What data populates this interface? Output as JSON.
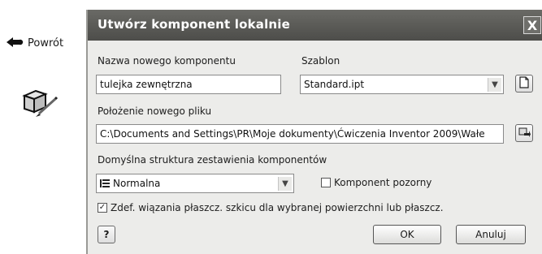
{
  "left_panel": {
    "back_label": "Powrót",
    "back_icon": "back-arrow-icon",
    "tool_icon": "create-component-icon"
  },
  "dialog": {
    "title": "Utwórz komponent lokalnie",
    "close_label": "X",
    "name_label": "Nazwa nowego komponentu",
    "name_value": "tulejka zewnętrzna",
    "template_label": "Szablon",
    "template_value": "Standard.ipt",
    "template_button_icon": "new-document-icon",
    "location_label": "Położenie nowego pliku",
    "location_value": "C:\\Documents and Settings\\PR\\Moje dokumenty\\Ćwiczenia Inventor 2009\\Wałe",
    "browse_button_icon": "browse-folder-icon",
    "bom_label": "Domyślna struktura zestawienia komponentów",
    "bom_value": "Normalna",
    "bom_icon": "bom-structure-icon",
    "virtual_label": "Komponent pozorny",
    "virtual_checked": false,
    "constraint_label": "Zdef. wiązania płaszcz. szkicu dla wybranej powierzchni lub płaszcz.",
    "constraint_checked": true,
    "help_label": "?",
    "ok_label": "OK",
    "cancel_label": "Anuluj"
  }
}
